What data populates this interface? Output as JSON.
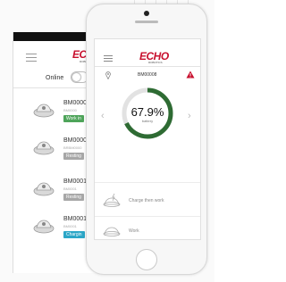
{
  "tablet": {
    "logo": "ECHO",
    "logo_sub": "ROBOTICS",
    "online_label": "Online",
    "robots": [
      {
        "id": "BM0000",
        "serial": "BM0000",
        "status": "Work in",
        "status_type": "work"
      },
      {
        "id": "BM0000",
        "serial": "BRBM0000",
        "status": "Resting",
        "status_type": "rest"
      },
      {
        "id": "BM0001",
        "serial": "BM0001",
        "status": "Resting",
        "status_type": "rest"
      },
      {
        "id": "BM0001",
        "serial": "BM0001",
        "status": "Chargin",
        "status_type": "charge"
      }
    ]
  },
  "phone": {
    "logo": "ECHO",
    "logo_sub": "ROBOTICS",
    "robot_name": "BM00008",
    "battery_percent": 67.9,
    "battery_text": "67.9%",
    "battery_label": "battery",
    "actions": [
      {
        "label": "Charge then work",
        "icon": "charge-then-work-icon"
      },
      {
        "label": "Work",
        "icon": "mower-icon"
      }
    ]
  },
  "colors": {
    "brand_red": "#c8102e",
    "gauge_green": "#2e6b33",
    "gauge_track": "#e2e2e2",
    "work": "#4ea45a",
    "rest": "#a7a7a7",
    "charge": "#2ba6c7"
  }
}
